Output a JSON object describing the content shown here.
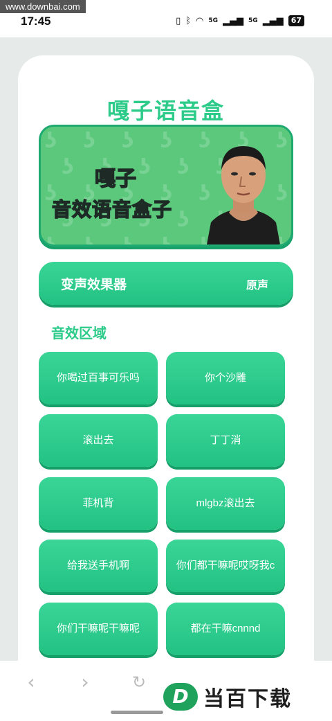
{
  "watermark": "www.downbai.com",
  "status": {
    "time": "17:45",
    "battery": "67",
    "net1": "5G",
    "net2": "5G"
  },
  "app": {
    "title": "嘎子语音盒"
  },
  "banner": {
    "line1": "嘎子",
    "line2": "音效语音盒子"
  },
  "voice_effect": {
    "label": "变声效果器",
    "value": "原声"
  },
  "section": {
    "title": "音效区域"
  },
  "sounds": [
    "你喝过百事可乐吗",
    "你个沙雕",
    "滚出去",
    "丁丁消",
    "菲机背",
    "mlgbz滚出去",
    "给我送手机啊",
    "你们都干嘛呢哎呀我c",
    "你们干嘛呢干嘛呢",
    "都在干嘛cnnnd"
  ],
  "nav": {
    "back_icon": "chevron-left-icon",
    "forward_icon": "chevron-right-icon",
    "refresh_icon": "refresh-icon"
  },
  "brand": {
    "logo_letter": "D",
    "name": "当百下载"
  },
  "colors": {
    "accent": "#2ccb89",
    "button": "#22c283",
    "banner": "#5bc87c"
  }
}
